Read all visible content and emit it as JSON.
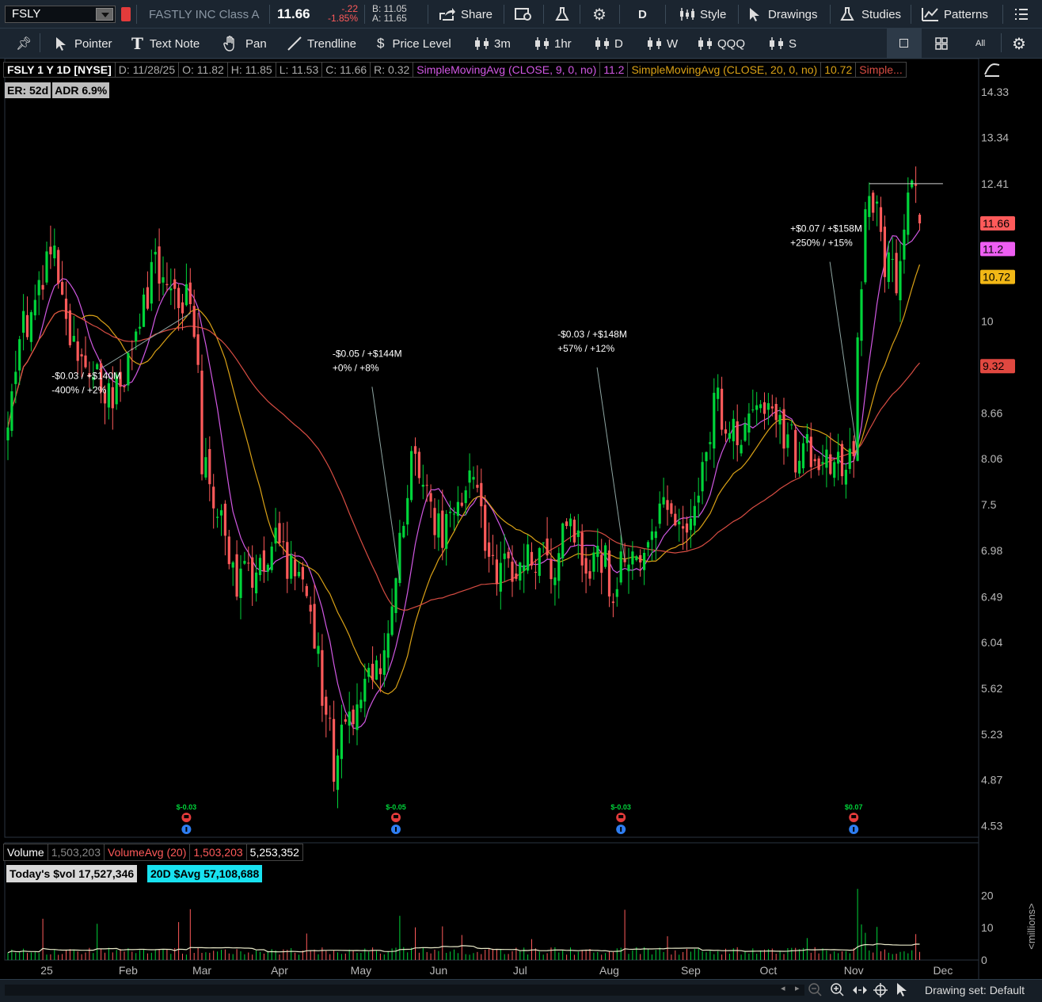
{
  "toolbar": {
    "symbol": "FSLY",
    "company": "FASTLY INC Class A",
    "last": "11.66",
    "change": "-.22",
    "change_pct": "-1.85%",
    "bid": "B: 11.05",
    "ask": "A: 11.65",
    "share": "Share",
    "period": "D",
    "style": "Style",
    "drawings": "Drawings",
    "studies": "Studies",
    "patterns": "Patterns"
  },
  "tools": {
    "pointer": "Pointer",
    "text_note": "Text Note",
    "pan": "Pan",
    "trendline": "Trendline",
    "price_level": "Price Level",
    "g1": "3m",
    "g2": "1hr",
    "g3": "D",
    "g4": "W",
    "g5": "QQQ",
    "g6": "S",
    "grid_label": "All"
  },
  "header": {
    "symbol": "FSLY 1 Y 1D [NYSE]",
    "date": "D: 11/28/25",
    "open": "O: 11.82",
    "high": "H: 11.85",
    "low": "L: 11.53",
    "close": "C: 11.66",
    "range": "R: 0.32",
    "sma9": "SimpleMovingAvg (CLOSE, 9, 0, no)",
    "sma9_val": "11.2",
    "sma20": "SimpleMovingAvg (CLOSE, 20, 0, no)",
    "sma20_val": "10.72",
    "sma50": "Simple...",
    "er": "ER: 52d",
    "adr": "ADR 6.9%"
  },
  "volume_header": {
    "label": "Volume",
    "value": "1,503,203",
    "avg_label": "VolumeAvg (20)",
    "avg_value": "1,503,203",
    "extra": "5,253,352",
    "today_dvol": "Today's $vol 17,527,346",
    "avg_dvol": "20D $Avg 57,108,688",
    "unit": "<millions>"
  },
  "status": {
    "drawing_set": "Drawing set: Default"
  },
  "colors": {
    "up": "#00d43a",
    "down": "#ff5a5a",
    "sma9": "#d158e3",
    "sma20": "#d9a116",
    "sma50": "#d84d43",
    "annot_line": "#8fa6a3"
  },
  "chart_data": {
    "type": "candlestick",
    "title": "FSLY 1 Y 1D [NYSE]",
    "y_ticks": [
      "14.33",
      "13.34",
      "12.41",
      "10",
      "8.66",
      "8.06",
      "7.5",
      "6.98",
      "6.49",
      "6.04",
      "5.62",
      "5.23",
      "4.87",
      "4.53"
    ],
    "y_tick_values": [
      14.33,
      13.34,
      12.41,
      10,
      8.66,
      8.06,
      7.5,
      6.98,
      6.49,
      6.04,
      5.62,
      5.23,
      4.87,
      4.53
    ],
    "ylim": [
      4.45,
      15.1
    ],
    "y_scale": "log",
    "x_ticks": [
      "25",
      "Feb",
      "Mar",
      "Apr",
      "May",
      "Jun",
      "Jul",
      "Aug",
      "Sep",
      "Oct",
      "Nov",
      "Dec"
    ],
    "x_tick_index": [
      10,
      31,
      50,
      70,
      91,
      111,
      132,
      155,
      176,
      196,
      218,
      241
    ],
    "bars": 236,
    "price_tags": [
      {
        "text": "11.66",
        "value": 11.66,
        "bg": "#ff5a5a",
        "fg": "#000000"
      },
      {
        "text": "11.2",
        "value": 11.2,
        "bg": "#ee5ef2",
        "fg": "#000000"
      },
      {
        "text": "10.72",
        "value": 10.72,
        "bg": "#f1b716",
        "fg": "#000000"
      },
      {
        "text": "9.32",
        "value": 9.32,
        "bg": "#e04840",
        "fg": "#000000"
      }
    ],
    "keypoints": [
      [
        0,
        8.4
      ],
      [
        4,
        9.9
      ],
      [
        9,
        10.6
      ],
      [
        12,
        11.2
      ],
      [
        14,
        10.2
      ],
      [
        18,
        9.4
      ],
      [
        22,
        9.2
      ],
      [
        27,
        8.9
      ],
      [
        30,
        9.1
      ],
      [
        35,
        10.3
      ],
      [
        38,
        10.8
      ],
      [
        42,
        10.2
      ],
      [
        46,
        10.4
      ],
      [
        49,
        9.6
      ],
      [
        50,
        8.1
      ],
      [
        53,
        7.7
      ],
      [
        57,
        6.9
      ],
      [
        60,
        6.6
      ],
      [
        64,
        6.8
      ],
      [
        68,
        7.1
      ],
      [
        71,
        7.0
      ],
      [
        75,
        6.6
      ],
      [
        79,
        6.2
      ],
      [
        82,
        5.4
      ],
      [
        84,
        5.0
      ],
      [
        87,
        5.3
      ],
      [
        90,
        5.6
      ],
      [
        94,
        5.8
      ],
      [
        98,
        6.0
      ],
      [
        101,
        7.2
      ],
      [
        104,
        8.0
      ],
      [
        107,
        7.8
      ],
      [
        109,
        7.3
      ],
      [
        112,
        7.2
      ],
      [
        116,
        7.5
      ],
      [
        119,
        7.9
      ],
      [
        121,
        7.7
      ],
      [
        124,
        6.8
      ],
      [
        127,
        6.7
      ],
      [
        131,
        6.9
      ],
      [
        135,
        7.0
      ],
      [
        138,
        6.9
      ],
      [
        141,
        6.9
      ],
      [
        144,
        7.2
      ],
      [
        147,
        7.1
      ],
      [
        150,
        6.85
      ],
      [
        154,
        6.95
      ],
      [
        156,
        6.4
      ],
      [
        158,
        7.2
      ],
      [
        161,
        6.9
      ],
      [
        164,
        7.05
      ],
      [
        167,
        7.4
      ],
      [
        170,
        7.5
      ],
      [
        173,
        7.35
      ],
      [
        176,
        7.35
      ],
      [
        179,
        7.8
      ],
      [
        182,
        8.8
      ],
      [
        185,
        8.6
      ],
      [
        188,
        8.5
      ],
      [
        191,
        8.6
      ],
      [
        194,
        8.9
      ],
      [
        197,
        8.7
      ],
      [
        200,
        8.4
      ],
      [
        203,
        8.15
      ],
      [
        206,
        8.25
      ],
      [
        209,
        8.1
      ],
      [
        212,
        8.0
      ],
      [
        215,
        8.05
      ],
      [
        218,
        8.0
      ],
      [
        219,
        9.7
      ],
      [
        221,
        11.8
      ],
      [
        223,
        12.0
      ],
      [
        226,
        11.1
      ],
      [
        229,
        10.5
      ],
      [
        231,
        11.6
      ],
      [
        233,
        12.3
      ],
      [
        235,
        11.66
      ]
    ],
    "annotations": [
      {
        "lines": [
          "-$0.03 / +$140M",
          "-400% / +2%"
        ],
        "bar": 47
      },
      {
        "lines": [
          "-$0.05 / +$144M",
          "+0% / +8%"
        ],
        "bar": 101
      },
      {
        "lines": [
          "-$0.03 / +$148M",
          "+57% / +12%"
        ],
        "bar": 159
      },
      {
        "lines": [
          "+$0.07 / +$158M",
          "+250% / +15%"
        ],
        "bar": 219
      }
    ],
    "earnings": [
      {
        "label": "$-0.03",
        "bar": 46
      },
      {
        "label": "$-0.05",
        "bar": 100
      },
      {
        "label": "$-0.03",
        "bar": 158
      },
      {
        "label": "$0.07",
        "bar": 218
      }
    ],
    "resistance": {
      "value": 12.41,
      "from_bar": 222,
      "to_bar": 241
    },
    "volume": {
      "y_ticks": [
        "20",
        "10",
        "0"
      ],
      "y_tick_values": [
        20,
        10,
        0
      ],
      "ylim": [
        0,
        24
      ],
      "unit": "millions"
    },
    "sma_periods": [
      9,
      20,
      50
    ]
  }
}
